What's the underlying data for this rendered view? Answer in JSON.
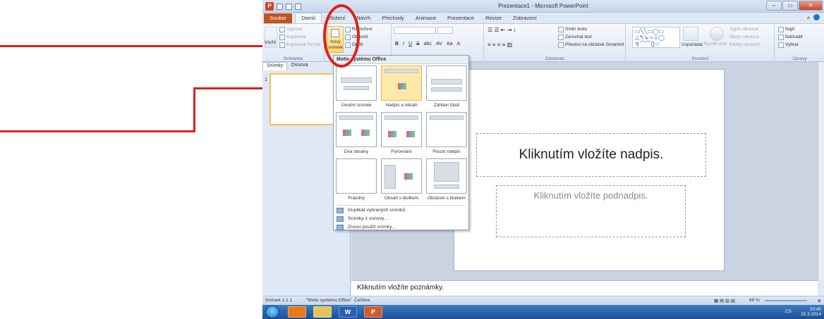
{
  "window": {
    "title": "Prezentace1 - Microsoft PowerPoint",
    "app_badge": "P",
    "buttons": [
      "–",
      "▭",
      "✕"
    ]
  },
  "tabs": [
    "Soubor",
    "Domů",
    "Vložení",
    "Návrh",
    "Přechody",
    "Animace",
    "Prezentace",
    "Revize",
    "Zobrazení"
  ],
  "ribbon": {
    "clipboard": {
      "cut": "Vyjmout",
      "copy": "Kopírovat",
      "format_painter": "Kopírovat formát",
      "paste": "Vložit",
      "label": "Schránka"
    },
    "slides": {
      "new_slide": "Nový",
      "new_slide_2": "snímek",
      "layout": "Rozložení",
      "reset": "Obnovit",
      "section": "Oddíl",
      "label": "Snímky"
    },
    "font": {
      "bold": "B",
      "italic": "I",
      "underline": "U",
      "strike": "S",
      "abc": "abc",
      "spacing": "AV",
      "case": "Aa",
      "color": "A"
    },
    "paragraph": {
      "text_direction": "Směr textu",
      "align_text": "Zarovnat text",
      "smartart": "Převést na obrázek SmartArt",
      "label": "Odstavec"
    },
    "drawing": {
      "arrange": "Uspořádat",
      "quick_styles": "Rychlé styly",
      "fill": "Výplň obrazce",
      "outline": "Obrys obrazce",
      "effects": "Efekty obrazců",
      "label": "Kreslení"
    },
    "editing": {
      "find": "Najít",
      "replace": "Nahradit",
      "select": "Vybrat",
      "label": "Úpravy"
    }
  },
  "left_pane": {
    "tabs": [
      "Snímky",
      "Osnova"
    ],
    "slide_number": "1"
  },
  "layout_dropdown": {
    "header": "Motiv systému Office",
    "layouts": [
      "Úvodní snímek",
      "Nadpis a obsah",
      "Záhlaví části",
      "Dva obsahy",
      "Porovnání",
      "Pouze nadpis",
      "Prázdný",
      "Obsah s titulkem",
      "Obrázek s titulkem"
    ],
    "menu": [
      "Duplikát vybraných snímků",
      "Snímky z osnovy...",
      "Znovu použít snímky..."
    ]
  },
  "slide": {
    "title_placeholder": "Kliknutím vložíte nadpis.",
    "subtitle_placeholder": "Kliknutím vložíte podnadpis."
  },
  "notes": {
    "placeholder": "Kliknutím vložíte poznámky."
  },
  "status": {
    "slide": "Snímek 1 z 1",
    "theme": "\"Motiv systému Office\"",
    "language": "Čeština",
    "zoom": "69 %"
  },
  "taskbar": {
    "lang": "CS",
    "time": "20:45",
    "date": "15.3.2014",
    "apps": [
      "",
      "",
      "W",
      "P"
    ]
  },
  "colors": {
    "annotation": "#e0201c",
    "file_tab": "#c2531d",
    "highlight": "#ffd86c"
  }
}
